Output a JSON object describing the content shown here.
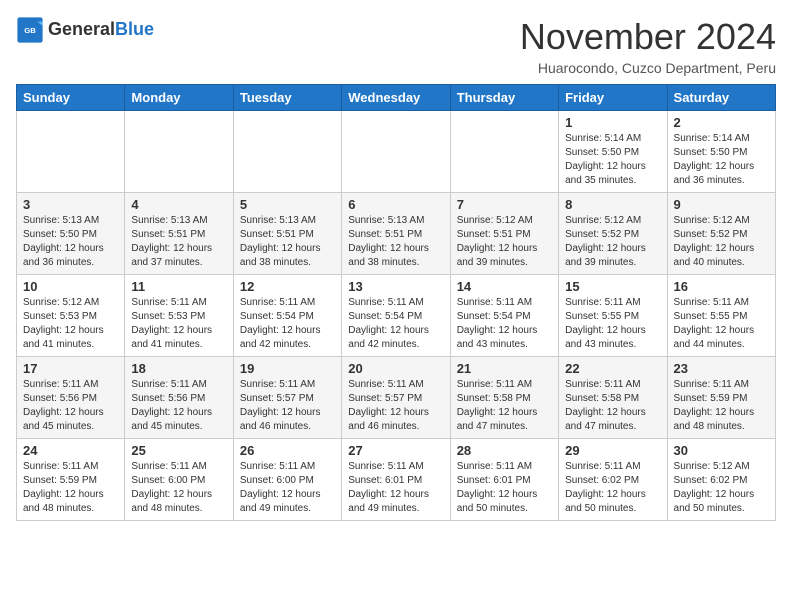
{
  "header": {
    "logo_line1": "General",
    "logo_line2": "Blue",
    "month": "November 2024",
    "location": "Huarocondo, Cuzco Department, Peru"
  },
  "weekdays": [
    "Sunday",
    "Monday",
    "Tuesday",
    "Wednesday",
    "Thursday",
    "Friday",
    "Saturday"
  ],
  "weeks": [
    [
      {
        "day": "",
        "info": ""
      },
      {
        "day": "",
        "info": ""
      },
      {
        "day": "",
        "info": ""
      },
      {
        "day": "",
        "info": ""
      },
      {
        "day": "",
        "info": ""
      },
      {
        "day": "1",
        "info": "Sunrise: 5:14 AM\nSunset: 5:50 PM\nDaylight: 12 hours\nand 35 minutes."
      },
      {
        "day": "2",
        "info": "Sunrise: 5:14 AM\nSunset: 5:50 PM\nDaylight: 12 hours\nand 36 minutes."
      }
    ],
    [
      {
        "day": "3",
        "info": "Sunrise: 5:13 AM\nSunset: 5:50 PM\nDaylight: 12 hours\nand 36 minutes."
      },
      {
        "day": "4",
        "info": "Sunrise: 5:13 AM\nSunset: 5:51 PM\nDaylight: 12 hours\nand 37 minutes."
      },
      {
        "day": "5",
        "info": "Sunrise: 5:13 AM\nSunset: 5:51 PM\nDaylight: 12 hours\nand 38 minutes."
      },
      {
        "day": "6",
        "info": "Sunrise: 5:13 AM\nSunset: 5:51 PM\nDaylight: 12 hours\nand 38 minutes."
      },
      {
        "day": "7",
        "info": "Sunrise: 5:12 AM\nSunset: 5:51 PM\nDaylight: 12 hours\nand 39 minutes."
      },
      {
        "day": "8",
        "info": "Sunrise: 5:12 AM\nSunset: 5:52 PM\nDaylight: 12 hours\nand 39 minutes."
      },
      {
        "day": "9",
        "info": "Sunrise: 5:12 AM\nSunset: 5:52 PM\nDaylight: 12 hours\nand 40 minutes."
      }
    ],
    [
      {
        "day": "10",
        "info": "Sunrise: 5:12 AM\nSunset: 5:53 PM\nDaylight: 12 hours\nand 41 minutes."
      },
      {
        "day": "11",
        "info": "Sunrise: 5:11 AM\nSunset: 5:53 PM\nDaylight: 12 hours\nand 41 minutes."
      },
      {
        "day": "12",
        "info": "Sunrise: 5:11 AM\nSunset: 5:54 PM\nDaylight: 12 hours\nand 42 minutes."
      },
      {
        "day": "13",
        "info": "Sunrise: 5:11 AM\nSunset: 5:54 PM\nDaylight: 12 hours\nand 42 minutes."
      },
      {
        "day": "14",
        "info": "Sunrise: 5:11 AM\nSunset: 5:54 PM\nDaylight: 12 hours\nand 43 minutes."
      },
      {
        "day": "15",
        "info": "Sunrise: 5:11 AM\nSunset: 5:55 PM\nDaylight: 12 hours\nand 43 minutes."
      },
      {
        "day": "16",
        "info": "Sunrise: 5:11 AM\nSunset: 5:55 PM\nDaylight: 12 hours\nand 44 minutes."
      }
    ],
    [
      {
        "day": "17",
        "info": "Sunrise: 5:11 AM\nSunset: 5:56 PM\nDaylight: 12 hours\nand 45 minutes."
      },
      {
        "day": "18",
        "info": "Sunrise: 5:11 AM\nSunset: 5:56 PM\nDaylight: 12 hours\nand 45 minutes."
      },
      {
        "day": "19",
        "info": "Sunrise: 5:11 AM\nSunset: 5:57 PM\nDaylight: 12 hours\nand 46 minutes."
      },
      {
        "day": "20",
        "info": "Sunrise: 5:11 AM\nSunset: 5:57 PM\nDaylight: 12 hours\nand 46 minutes."
      },
      {
        "day": "21",
        "info": "Sunrise: 5:11 AM\nSunset: 5:58 PM\nDaylight: 12 hours\nand 47 minutes."
      },
      {
        "day": "22",
        "info": "Sunrise: 5:11 AM\nSunset: 5:58 PM\nDaylight: 12 hours\nand 47 minutes."
      },
      {
        "day": "23",
        "info": "Sunrise: 5:11 AM\nSunset: 5:59 PM\nDaylight: 12 hours\nand 48 minutes."
      }
    ],
    [
      {
        "day": "24",
        "info": "Sunrise: 5:11 AM\nSunset: 5:59 PM\nDaylight: 12 hours\nand 48 minutes."
      },
      {
        "day": "25",
        "info": "Sunrise: 5:11 AM\nSunset: 6:00 PM\nDaylight: 12 hours\nand 48 minutes."
      },
      {
        "day": "26",
        "info": "Sunrise: 5:11 AM\nSunset: 6:00 PM\nDaylight: 12 hours\nand 49 minutes."
      },
      {
        "day": "27",
        "info": "Sunrise: 5:11 AM\nSunset: 6:01 PM\nDaylight: 12 hours\nand 49 minutes."
      },
      {
        "day": "28",
        "info": "Sunrise: 5:11 AM\nSunset: 6:01 PM\nDaylight: 12 hours\nand 50 minutes."
      },
      {
        "day": "29",
        "info": "Sunrise: 5:11 AM\nSunset: 6:02 PM\nDaylight: 12 hours\nand 50 minutes."
      },
      {
        "day": "30",
        "info": "Sunrise: 5:12 AM\nSunset: 6:02 PM\nDaylight: 12 hours\nand 50 minutes."
      }
    ]
  ]
}
